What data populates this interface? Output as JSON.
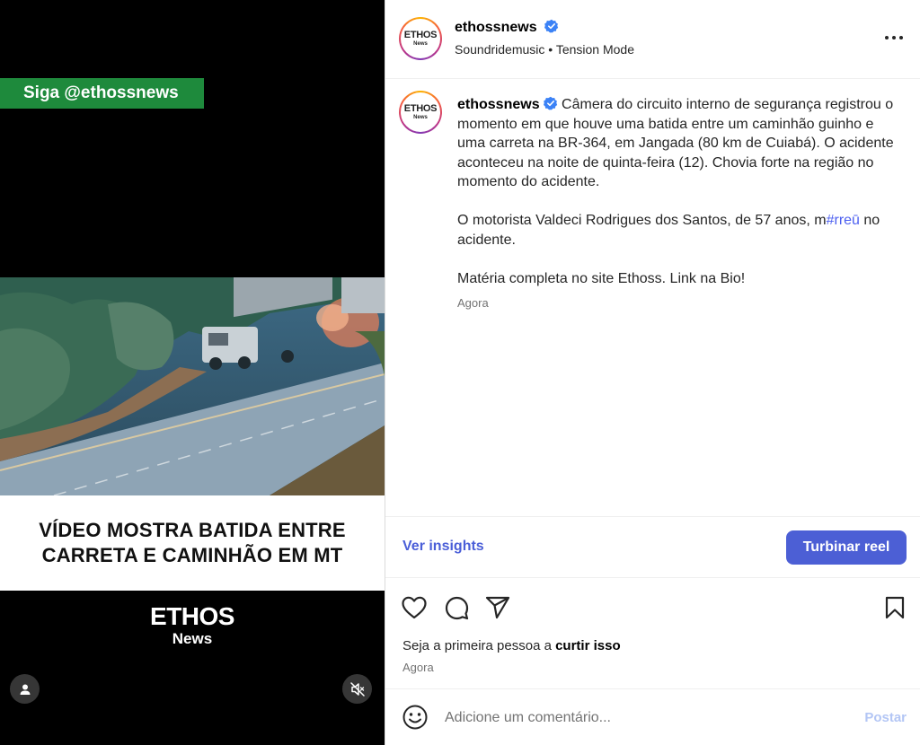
{
  "video": {
    "overlay_follow": "Siga @ethossnews",
    "headline_line1": "VÍDEO MOSTRA BATIDA ENTRE",
    "headline_line2": "CARRETA E CAMINHÃO EM MT",
    "brand_name": "ETHOS",
    "brand_sub": "News",
    "tags_icon": "user-icon",
    "mute_icon": "speaker-muted-icon"
  },
  "header": {
    "avatar_line1": "ETHOS",
    "avatar_line2": "News",
    "username": "ethossnews",
    "audio": "Soundridemusic • Tension Mode",
    "more_icon": "more-horizontal-icon"
  },
  "caption": {
    "username": "ethossnews",
    "paragraph1": "Câmera do circuito interno de segurança registrou o momento em que houve uma batida entre um caminhão guinho e uma carreta na BR-364, em Jangada (80 km de Cuiabá). O acidente aconteceu na noite de quinta-feira (12). Chovia forte na região no momento do acidente.",
    "paragraph2_before": "O motorista Valdeci Rodrigues dos Santos, de 57 anos, m",
    "paragraph2_tag": "#rreū",
    "paragraph2_after": " no acidente.",
    "paragraph3": "Matéria completa no site Ethoss. Link na Bio!",
    "time": "Agora"
  },
  "insights": {
    "link": "Ver insights",
    "boost_button": "Turbinar reel"
  },
  "actions": {
    "like_icon": "heart-icon",
    "comment_icon": "comment-icon",
    "share_icon": "share-icon",
    "save_icon": "bookmark-icon",
    "likes_prefix": "Seja a primeira pessoa a ",
    "likes_strong": "curtir isso",
    "time": "Agora"
  },
  "comment": {
    "emoji_icon": "emoji-icon",
    "placeholder": "Adicione um comentário...",
    "post_button": "Postar"
  },
  "colors": {
    "follow_banner": "#1e8a3c",
    "accent_blue": "#4c5fd5",
    "hashtag": "#4c5ff0",
    "post_disabled": "#b3c6f5"
  }
}
